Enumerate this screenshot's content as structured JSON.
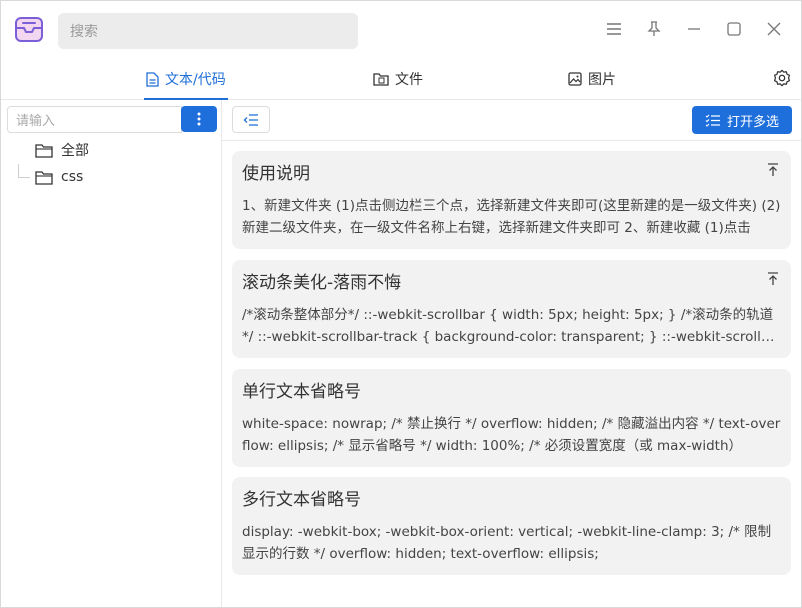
{
  "search": {
    "placeholder": "搜索"
  },
  "tabs": [
    {
      "label": "文本/代码",
      "icon": "document-icon",
      "active": true
    },
    {
      "label": "文件",
      "icon": "folder-file-icon",
      "active": false
    },
    {
      "label": "图片",
      "icon": "image-icon",
      "active": false
    }
  ],
  "sidebar": {
    "input_placeholder": "请输入",
    "tree": [
      {
        "label": "全部",
        "icon": "folder-icon"
      },
      {
        "label": "css",
        "icon": "folder-icon"
      }
    ]
  },
  "toolbar": {
    "multi_select_label": "打开多选"
  },
  "cards": [
    {
      "title": "使用说明",
      "pinned": true,
      "body": "1、新建文件夹 (1)点击侧边栏三个点，选择新建文件夹即可(这里新建的是一级文件夹) (2)新建二级文件夹，在一级文件名称上右键，选择新建文件夹即可 2、新建收藏 (1)点击"
    },
    {
      "title": "滚动条美化-落雨不悔",
      "pinned": true,
      "body": "/*滚动条整体部分*/ ::-webkit-scrollbar { width: 5px; height: 5px; } /*滚动条的轨道*/ ::-webkit-scrollbar-track { background-color: transparent; } ::-webkit-scrollbar-thumb"
    },
    {
      "title": "单行文本省略号",
      "pinned": false,
      "body": "white-space: nowrap; /* 禁止换行 */ overflow: hidden; /* 隐藏溢出内容 */ text-overflow: ellipsis; /* 显示省略号 */ width: 100%; /* 必须设置宽度（或 max-width）"
    },
    {
      "title": "多行文本省略号",
      "pinned": false,
      "body": "display: -webkit-box; -webkit-box-orient: vertical; -webkit-line-clamp: 3; /* 限制显示的行数 */ overflow: hidden; text-overflow: ellipsis;"
    }
  ],
  "colors": {
    "accent": "#1e6fdb",
    "card_bg": "#f2f2f2"
  }
}
